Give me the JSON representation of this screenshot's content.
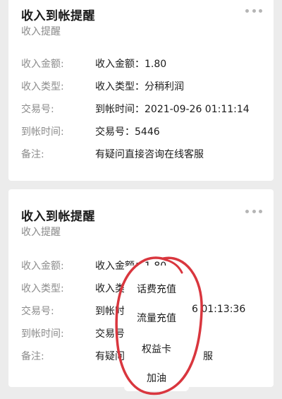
{
  "cards": [
    {
      "title": "收入到帐提醒",
      "subtitle": "收入提醒",
      "rows": [
        {
          "label": "收入金额:",
          "value": "收入金额：1.80"
        },
        {
          "label": "收入类型:",
          "value": "收入类型：分稍利润"
        },
        {
          "label": "交易号:",
          "value": "到帐时间：2021-09-26 01:11:14"
        },
        {
          "label": "到帐时间:",
          "value": "交易号：5446"
        },
        {
          "label": "备注:",
          "value": "有疑问直接咨询在线客服"
        }
      ]
    },
    {
      "title": "收入到帐提醒",
      "subtitle": "收入提醒",
      "rows": [
        {
          "label": "收入金额:",
          "value": "收入金额：1.80"
        },
        {
          "label": "收入类型:",
          "value": "收入类型"
        },
        {
          "label": "交易号:",
          "value": "到帐时",
          "value_tail": "6 01:13:36"
        },
        {
          "label": "到帐时间:",
          "value": "交易号"
        },
        {
          "label": "备注:",
          "value": "有疑问",
          "value_tail": "服"
        }
      ]
    }
  ],
  "popup_menu": [
    "话费充值",
    "流量充值",
    "权益卡",
    "加油"
  ],
  "colors": {
    "annotation": "#d9363e",
    "background": "#ececec"
  }
}
